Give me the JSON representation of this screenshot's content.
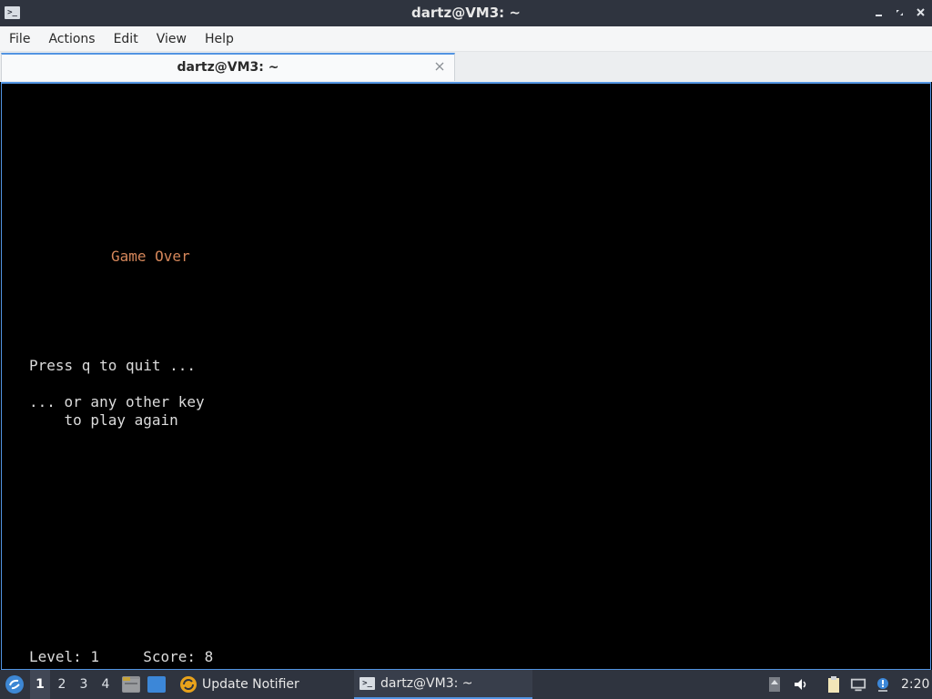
{
  "window": {
    "title": "dartz@VM3: ~",
    "icon": "terminal-icon",
    "controls": [
      "minimize-icon",
      "restore-icon",
      "close-icon"
    ]
  },
  "menubar": {
    "items": [
      "File",
      "Actions",
      "Edit",
      "View",
      "Help"
    ]
  },
  "tabs": [
    {
      "label": "dartz@VM3: ~",
      "active": true
    }
  ],
  "terminal": {
    "game_over": "Game Over",
    "press_q": "Press q to quit ...",
    "other_key": "... or any other key",
    "play_again": "    to play again",
    "status": "Level: 1     Score: 8",
    "background": "#000000",
    "text_color": "#dcdcdc",
    "accent_color": "#d4865a"
  },
  "taskbar": {
    "workspaces": [
      "1",
      "2",
      "3",
      "4"
    ],
    "active_workspace": "1",
    "tasks": [
      {
        "label": "Update Notifier",
        "icon": "update-notifier-icon"
      },
      {
        "label": "dartz@VM3: ~",
        "icon": "terminal-icon",
        "active": true
      }
    ],
    "tray": [
      "upload-icon",
      "volume-icon",
      "clipboard-icon",
      "network-icon",
      "notification-icon"
    ],
    "clock": "2:20"
  }
}
